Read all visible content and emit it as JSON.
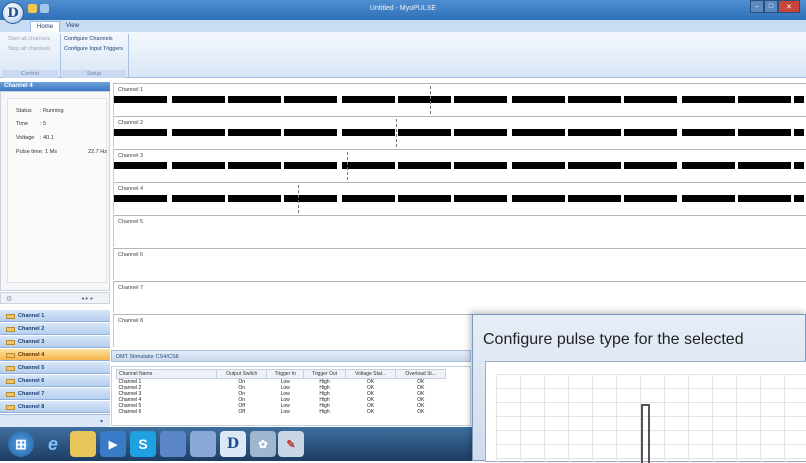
{
  "window": {
    "title": "Untitled - MyoPULSE"
  },
  "ribbon": {
    "tabs": [
      "Home",
      "View"
    ],
    "control": {
      "buttons": [
        "Start all channels",
        "Stop all channels"
      ],
      "caption": "Control"
    },
    "setup": {
      "buttons": [
        "Configure Channels",
        "Configure Input Triggers"
      ],
      "caption": "Setup"
    }
  },
  "left_panel": {
    "header": "Channel 4",
    "status": [
      {
        "key": "Status",
        "value": ": Running"
      },
      {
        "key": "Time",
        "value": ": 5"
      },
      {
        "key": "Voltage",
        "value": ": 40.1"
      },
      {
        "key": "Pulse time",
        "value": ": 1 Ms",
        "extra": "22.7 Hz"
      }
    ],
    "nav": [
      "Channel 1",
      "Channel 2",
      "Channel 3",
      "Channel 4",
      "Channel 5",
      "Channel 6",
      "Channel 7",
      "Channel 8"
    ],
    "selected_index": 3
  },
  "channels": [
    "Channel 1",
    "Channel 2",
    "Channel 3",
    "Channel 4",
    "Channel 5",
    "Channel 6",
    "Channel 7",
    "Channel 8"
  ],
  "dmt": {
    "title": "DMT Stimulator CS4/CS8",
    "columns": [
      "Channel Name",
      "Output Switch",
      "Trigger In",
      "Trigger Out",
      "Voltage Stat...",
      "Overload St..."
    ],
    "rows": [
      [
        "Channel 1",
        "On",
        "Low",
        "High",
        "OK",
        "OK"
      ],
      [
        "Channel 2",
        "On",
        "Low",
        "High",
        "OK",
        "OK"
      ],
      [
        "Channel 3",
        "On",
        "Low",
        "High",
        "OK",
        "OK"
      ],
      [
        "Channel 4",
        "On",
        "Low",
        "High",
        "OK",
        "OK"
      ],
      [
        "Channel 5",
        "Off",
        "Low",
        "High",
        "OK",
        "OK"
      ],
      [
        "Channel 6",
        "Off",
        "Low",
        "High",
        "OK",
        "OK"
      ]
    ]
  },
  "dialog": {
    "title": "Configure pulse type for the selected"
  },
  "colors": {
    "accent": "#3d76c0",
    "selected": "#f7b44c",
    "taskbar": "#1c3d63"
  },
  "taskbar_icons": [
    "windows-start-icon",
    "internet-explorer-icon",
    "file-explorer-icon",
    "media-player-icon",
    "skype-icon",
    "app-icon",
    "app-icon",
    "myopulse-icon",
    "tool-icon",
    "paint-icon"
  ]
}
